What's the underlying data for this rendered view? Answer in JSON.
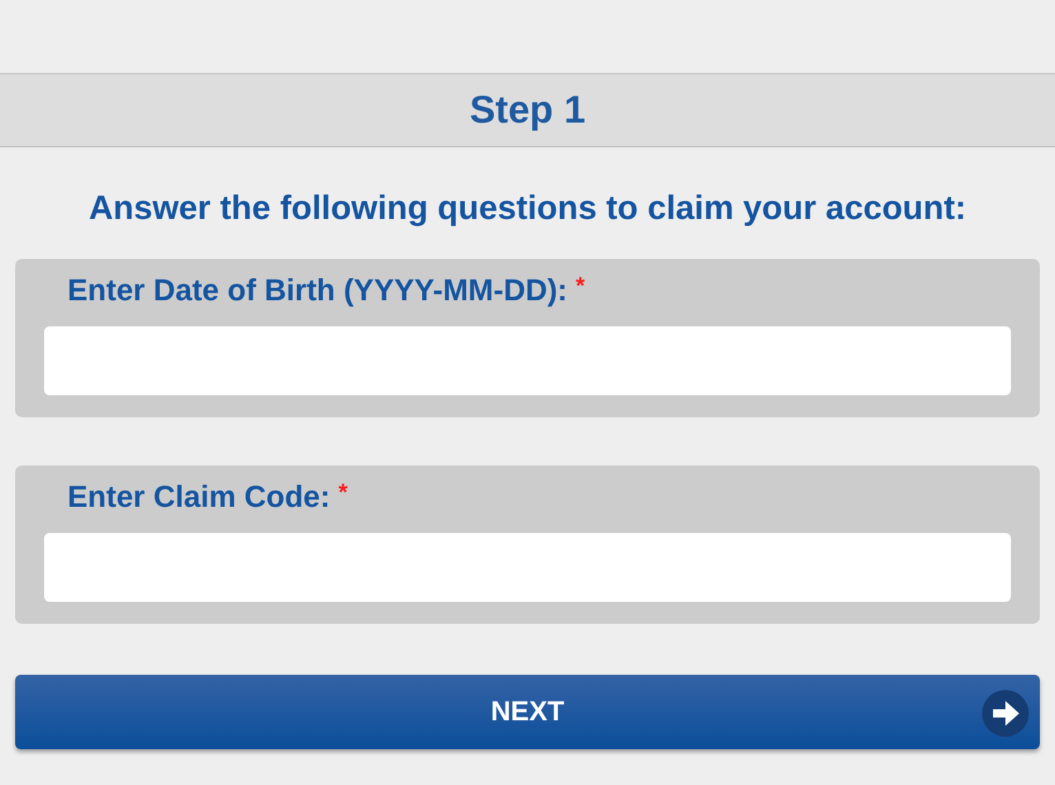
{
  "header": {
    "title": "Step 1"
  },
  "instructions": "Answer the following questions to claim your account:",
  "fields": [
    {
      "label": "Enter Date of Birth (YYYY-MM-DD):",
      "required_mark": "*"
    },
    {
      "label": "Enter Claim Code:",
      "required_mark": "*"
    }
  ],
  "next_button": {
    "label": "NEXT"
  }
}
